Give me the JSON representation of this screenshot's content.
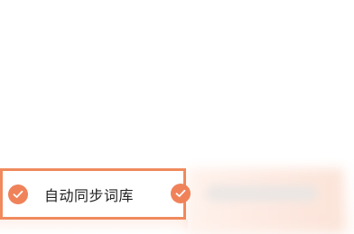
{
  "sync_option": {
    "label": "自动同步词库",
    "checked": true,
    "check_icon": "checkmark-icon"
  },
  "colors": {
    "accent": "#f0825a",
    "card_border": "#f08a5d"
  }
}
